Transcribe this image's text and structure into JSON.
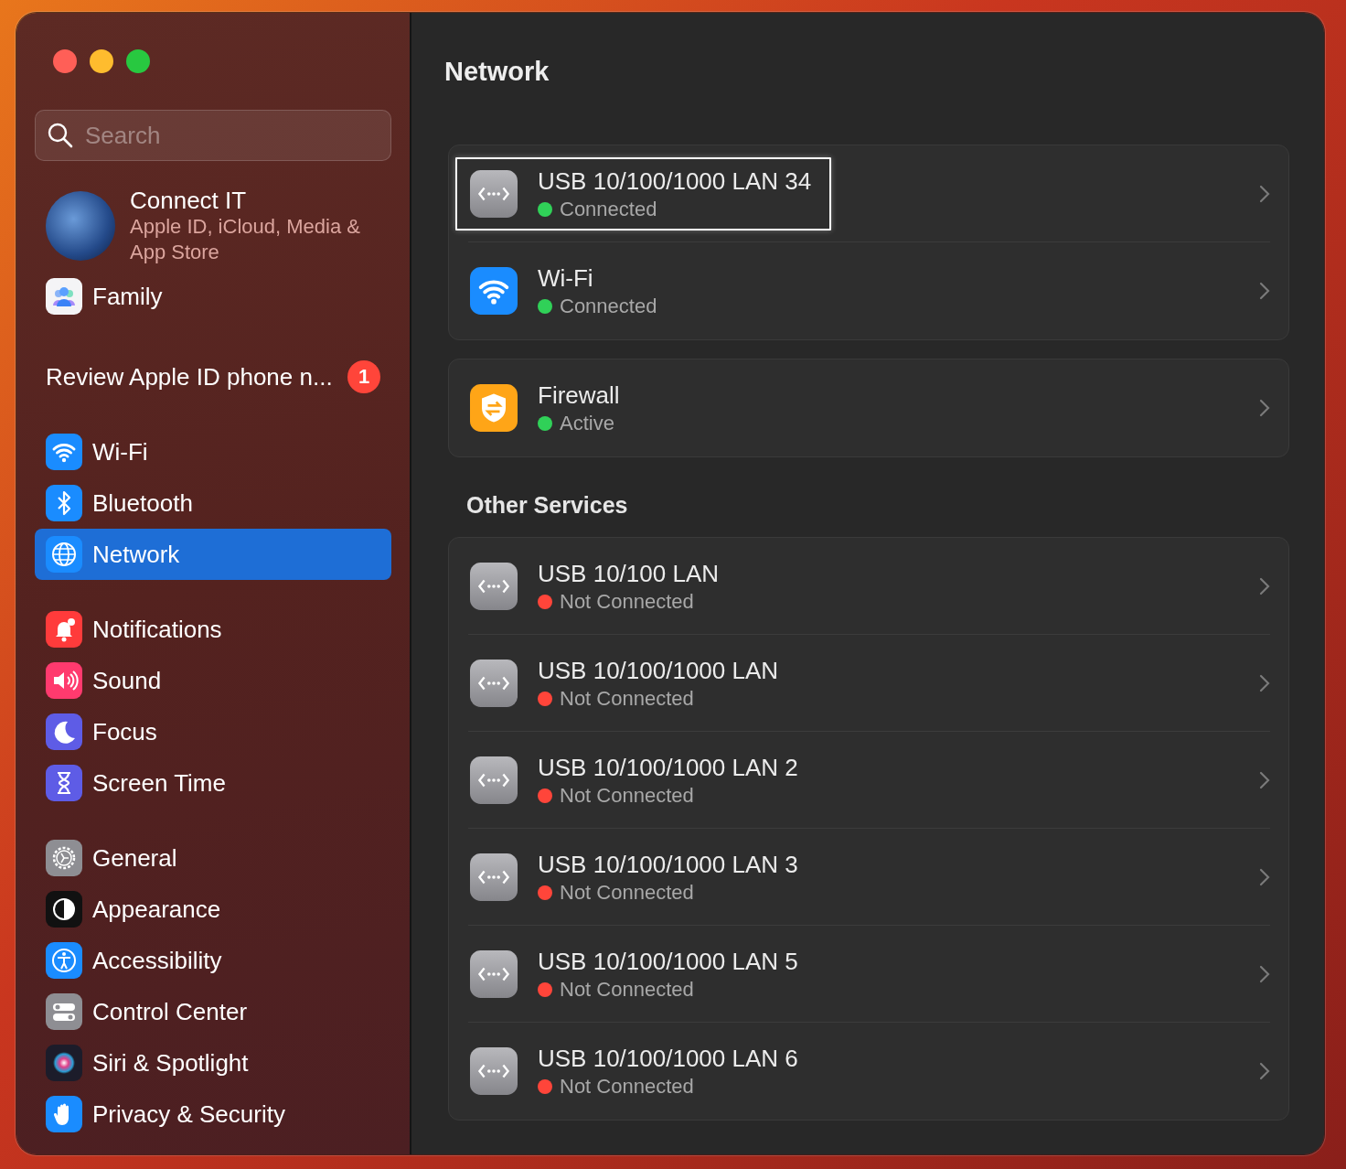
{
  "window": {
    "controls": [
      {
        "kind": "close"
      },
      {
        "kind": "minimize"
      },
      {
        "kind": "zoom"
      }
    ]
  },
  "sidebar": {
    "search": {
      "placeholder": "Search"
    },
    "account": {
      "name": "Connect IT",
      "subtitle": "Apple ID, iCloud, Media & App Store"
    },
    "family": {
      "label": "Family",
      "kind": "family"
    },
    "notice": {
      "label": "Review Apple ID phone n...",
      "badge": "1"
    },
    "groups": [
      [
        {
          "label": "Wi-Fi",
          "kind": "wifi",
          "selected": false
        },
        {
          "label": "Bluetooth",
          "kind": "bluetooth",
          "selected": false
        },
        {
          "label": "Network",
          "kind": "network",
          "selected": true
        }
      ],
      [
        {
          "label": "Notifications",
          "kind": "notifications",
          "selected": false
        },
        {
          "label": "Sound",
          "kind": "sound",
          "selected": false
        },
        {
          "label": "Focus",
          "kind": "focus",
          "selected": false
        },
        {
          "label": "Screen Time",
          "kind": "screentime",
          "selected": false
        }
      ],
      [
        {
          "label": "General",
          "kind": "general",
          "selected": false
        },
        {
          "label": "Appearance",
          "kind": "appearance",
          "selected": false
        },
        {
          "label": "Accessibility",
          "kind": "accessibility",
          "selected": false
        },
        {
          "label": "Control Center",
          "kind": "controlcenter",
          "selected": false
        },
        {
          "label": "Siri & Spotlight",
          "kind": "siri",
          "selected": false
        },
        {
          "label": "Privacy & Security",
          "kind": "privacy",
          "selected": false
        }
      ]
    ]
  },
  "main": {
    "title": "Network",
    "cards": [
      {
        "rows": [
          {
            "name": "USB 10/100/1000 LAN 34",
            "status": "Connected",
            "color": "#30d158",
            "kind": "ethernet",
            "focused": true
          },
          {
            "name": "Wi-Fi",
            "status": "Connected",
            "color": "#30d158",
            "kind": "wifi",
            "focused": false
          }
        ]
      },
      {
        "rows": [
          {
            "name": "Firewall",
            "status": "Active",
            "color": "#30d158",
            "kind": "firewall",
            "focused": false
          }
        ]
      },
      {
        "heading": "Other Services",
        "rows": [
          {
            "name": "USB 10/100 LAN",
            "status": "Not Connected",
            "color": "#ff453a",
            "kind": "ethernet",
            "focused": false
          },
          {
            "name": "USB 10/100/1000 LAN",
            "status": "Not Connected",
            "color": "#ff453a",
            "kind": "ethernet",
            "focused": false
          },
          {
            "name": "USB 10/100/1000 LAN 2",
            "status": "Not Connected",
            "color": "#ff453a",
            "kind": "ethernet",
            "focused": false
          },
          {
            "name": "USB 10/100/1000 LAN 3",
            "status": "Not Connected",
            "color": "#ff453a",
            "kind": "ethernet",
            "focused": false
          },
          {
            "name": "USB 10/100/1000 LAN 5",
            "status": "Not Connected",
            "color": "#ff453a",
            "kind": "ethernet",
            "focused": false
          },
          {
            "name": "USB 10/100/1000 LAN 6",
            "status": "Not Connected",
            "color": "#ff453a",
            "kind": "ethernet",
            "focused": false
          }
        ]
      }
    ]
  }
}
